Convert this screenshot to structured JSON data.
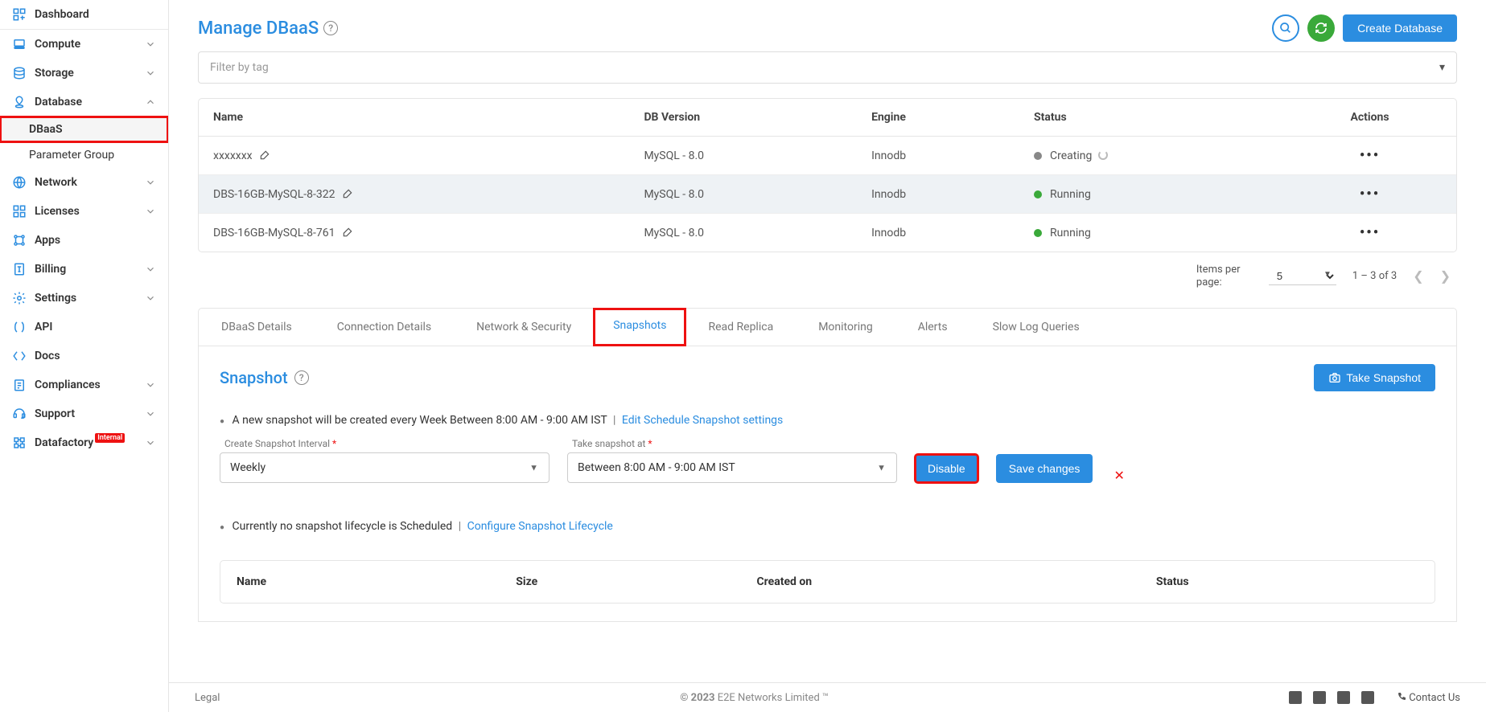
{
  "sidebar": {
    "items": [
      {
        "label": "Dashboard",
        "icon": "dashboard"
      },
      {
        "label": "Compute",
        "icon": "compute",
        "exp": true
      },
      {
        "label": "Storage",
        "icon": "storage",
        "exp": true
      },
      {
        "label": "Database",
        "icon": "database",
        "exp": true,
        "open": true,
        "highlight_sub": 0,
        "subs": [
          {
            "label": "DBaaS"
          },
          {
            "label": "Parameter Group"
          }
        ]
      },
      {
        "label": "Network",
        "icon": "network",
        "exp": true
      },
      {
        "label": "Licenses",
        "icon": "licenses",
        "exp": true
      },
      {
        "label": "Apps",
        "icon": "apps"
      },
      {
        "label": "Billing",
        "icon": "billing",
        "exp": true
      },
      {
        "label": "Settings",
        "icon": "settings",
        "exp": true
      },
      {
        "label": "API",
        "icon": "api"
      },
      {
        "label": "Docs",
        "icon": "docs"
      },
      {
        "label": "Compliances",
        "icon": "compliances",
        "exp": true
      },
      {
        "label": "Support",
        "icon": "support",
        "exp": true
      },
      {
        "label": "Datafactory",
        "icon": "datafactory",
        "exp": true,
        "badge": "Internal"
      }
    ]
  },
  "header": {
    "title": "Manage DBaaS",
    "create_btn": "Create Database",
    "filter_placeholder": "Filter by tag"
  },
  "db_table": {
    "columns": [
      "Name",
      "DB Version",
      "Engine",
      "Status",
      "Actions"
    ],
    "rows": [
      {
        "name": "xxxxxxx",
        "ver": "MySQL - 8.0",
        "engine": "Innodb",
        "status": "Creating",
        "dot": "grey",
        "spinner": true
      },
      {
        "name": "DBS-16GB-MySQL-8-322",
        "ver": "MySQL - 8.0",
        "engine": "Innodb",
        "status": "Running",
        "dot": "green",
        "selected": true
      },
      {
        "name": "DBS-16GB-MySQL-8-761",
        "ver": "MySQL - 8.0",
        "engine": "Innodb",
        "status": "Running",
        "dot": "green"
      }
    ]
  },
  "pager": {
    "ipp_label": "Items per page:",
    "ipp_value": "5",
    "range": "1 – 3 of 3"
  },
  "tabs": [
    "DBaaS Details",
    "Connection Details",
    "Network & Security",
    "Snapshots",
    "Read Replica",
    "Monitoring",
    "Alerts",
    "Slow Log Queries"
  ],
  "active_tab": 3,
  "snapshot": {
    "title": "Snapshot",
    "take_btn": "Take Snapshot",
    "sched_text": "A new snapshot will be created every Week Between 8:00 AM - 9:00 AM IST",
    "sched_edit_link": "Edit Schedule Snapshot settings",
    "interval_label": "Create Snapshot Interval",
    "interval_value": "Weekly",
    "time_label": "Take snapshot at",
    "time_value": "Between 8:00 AM - 9:00 AM IST",
    "disable_btn": "Disable",
    "save_btn": "Save changes",
    "lifecycle_text": "Currently no snapshot lifecycle is Scheduled",
    "lifecycle_link": "Configure Snapshot Lifecycle",
    "table_columns": [
      "Name",
      "Size",
      "Created on",
      "Status"
    ]
  },
  "footer": {
    "legal": "Legal",
    "copyright_bold": "© 2023",
    "copyright_rest": " E2E Networks Limited ™",
    "contact": "Contact Us"
  }
}
